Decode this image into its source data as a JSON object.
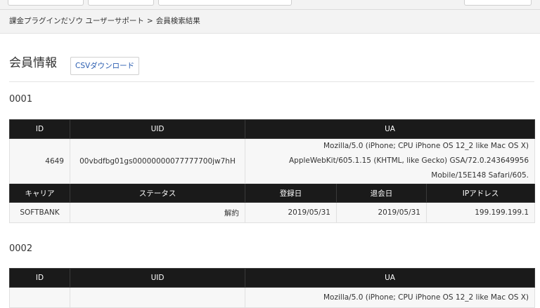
{
  "breadcrumb": {
    "root": "課金プラグインだゾウ ユーザーサポート",
    "separator": ">",
    "current": "会員検索結果"
  },
  "page": {
    "title": "会員情報",
    "csv_button": "CSVダウンロード"
  },
  "headers": {
    "id": "ID",
    "uid": "UID",
    "ua": "UA",
    "carrier": "キャリア",
    "status": "ステータス",
    "registered": "登録日",
    "withdrawn": "退会日",
    "ip": "IPアドレス"
  },
  "records": [
    {
      "no": "0001",
      "id": "4649",
      "uid": "00vbdfbg01gs00000000077777700jw7hH",
      "ua_lines": [
        "Mozilla/5.0 (iPhone; CPU iPhone OS 12_2 like Mac OS X)",
        "AppleWebKit/605.1.15 (KHTML, like Gecko) GSA/72.0.243649956",
        "Mobile/15E148 Safari/605."
      ],
      "carrier": "SOFTBANK",
      "status": "解約",
      "registered": "2019/05/31",
      "withdrawn": "2019/05/31",
      "ip": "199.199.199.1"
    },
    {
      "no": "0002",
      "ua_lines": [
        "Mozilla/5.0 (iPhone; CPU iPhone OS 12_2 like Mac OS X)"
      ]
    }
  ]
}
